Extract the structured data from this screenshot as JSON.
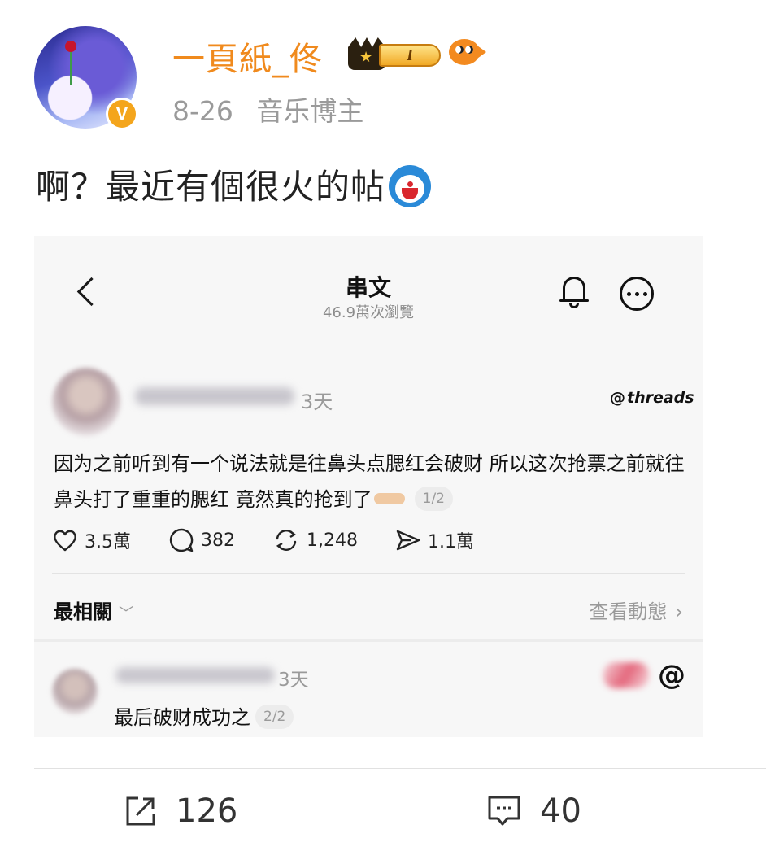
{
  "post": {
    "author": "一頁紙_佟",
    "level_badge": "I",
    "date": "8-26",
    "tag": "音乐博主",
    "text": "啊？最近有個很火的帖",
    "verified_badge": "V",
    "icons": [
      "crown-level-badge-icon",
      "fish-emoji-icon",
      "doraemon-emoji-icon"
    ]
  },
  "embed": {
    "title": "串文",
    "views": "46.9萬次瀏覽",
    "header_icons": [
      "back-arrow-icon",
      "bell-icon",
      "more-options-icon"
    ],
    "thread": {
      "time": "3天",
      "brand": "threads",
      "body": "因为之前听到有一个说法就是往鼻头点腮红会破财 所以这次抢票之前就往鼻头打了重重的腮红 竟然真的抢到了",
      "page": "1/2",
      "likes": "3.5萬",
      "replies": "382",
      "reposts": "1,248",
      "shares": "1.1萬"
    },
    "section": {
      "title": "最相關",
      "view_activity": "查看動態"
    },
    "reply": {
      "time": "3天",
      "body": "最后破财成功之",
      "page": "2/2"
    }
  },
  "footer": {
    "share_count": "126",
    "comment_count": "40"
  },
  "colors": {
    "username": "#f08a1d",
    "meta": "#9a9a9a",
    "embed_bg": "#f7f7f7",
    "text": "#222222"
  }
}
